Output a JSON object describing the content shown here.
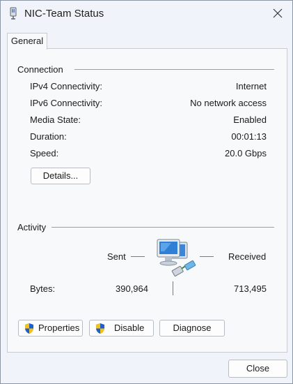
{
  "window": {
    "title": "NIC-Team Status"
  },
  "tabs": [
    {
      "label": "General"
    }
  ],
  "connection": {
    "heading": "Connection",
    "rows": [
      {
        "label": "IPv4 Connectivity:",
        "value": "Internet"
      },
      {
        "label": "IPv6 Connectivity:",
        "value": "No network access"
      },
      {
        "label": "Media State:",
        "value": "Enabled"
      },
      {
        "label": "Duration:",
        "value": "00:01:13"
      },
      {
        "label": "Speed:",
        "value": "20.0 Gbps"
      }
    ],
    "details_label": "Details..."
  },
  "activity": {
    "heading": "Activity",
    "sent_label": "Sent",
    "received_label": "Received",
    "bytes_label": "Bytes:",
    "bytes_sent": "390,964",
    "bytes_received": "713,495"
  },
  "actions": {
    "properties_label": "Properties",
    "disable_label": "Disable",
    "diagnose_label": "Diagnose"
  },
  "footer": {
    "close_label": "Close"
  },
  "icons": {
    "window_icon": "network-adapter-icon",
    "close": "close-icon",
    "shield": "uac-shield-icon",
    "activity": "network-computers-icon"
  },
  "colors": {
    "window_bg": "#f0f3f9",
    "panel_bg": "#f8f9fb",
    "shield_blue": "#1f5fc7",
    "shield_yellow": "#f3c21b",
    "monitor_blue": "#2f7fd6"
  }
}
